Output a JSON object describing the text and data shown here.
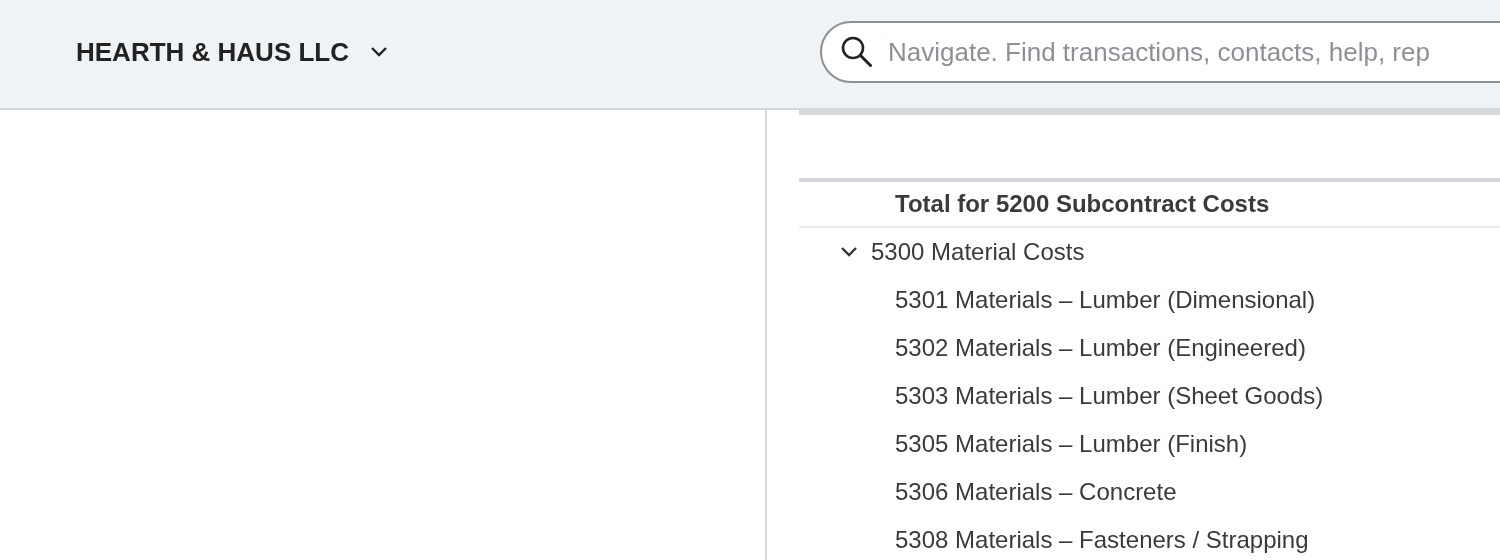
{
  "company": {
    "name": "HEARTH & HAUS LLC"
  },
  "search": {
    "placeholder": "Navigate. Find transactions, contacts, help, rep"
  },
  "report": {
    "rows": [
      {
        "kind": "total",
        "label": "Total for 5200 Subcontract Costs"
      },
      {
        "kind": "group",
        "label": "5300 Material Costs",
        "expanded": true,
        "children": [
          {
            "label": "5301 Materials – Lumber (Dimensional)"
          },
          {
            "label": "5302 Materials – Lumber (Engineered)"
          },
          {
            "label": "5303 Materials – Lumber (Sheet Goods)"
          },
          {
            "label": "5305 Materials – Lumber (Finish)"
          },
          {
            "label": "5306 Materials – Concrete"
          },
          {
            "label": "5308 Materials – Fasteners / Strapping"
          }
        ]
      }
    ]
  }
}
